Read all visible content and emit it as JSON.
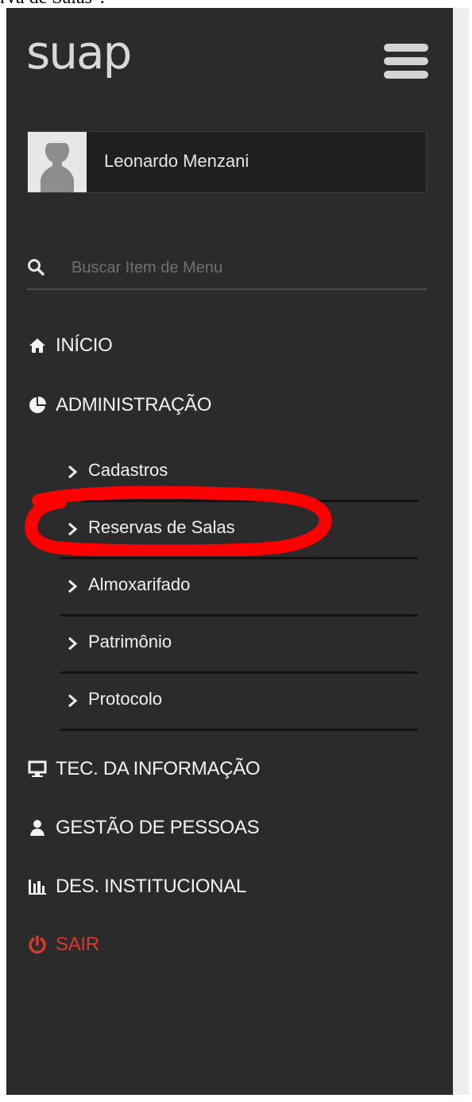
{
  "top_text": "rva de Salas\".",
  "brand": {
    "logo_text": "suap"
  },
  "user": {
    "name": "Leonardo Menzani"
  },
  "search": {
    "placeholder": "Buscar Item de Menu",
    "value": ""
  },
  "nav": {
    "items": [
      {
        "label": "INÍCIO",
        "icon": "home-icon"
      },
      {
        "label": "ADMINISTRAÇÃO",
        "icon": "pie-chart-icon"
      },
      {
        "label": "TEC. DA INFORMAÇÃO",
        "icon": "monitor-icon"
      },
      {
        "label": "GESTÃO DE PESSOAS",
        "icon": "person-icon"
      },
      {
        "label": "DES. INSTITUCIONAL",
        "icon": "bar-chart-icon"
      },
      {
        "label": "SAIR",
        "icon": "power-icon"
      }
    ],
    "administration_submenu": [
      {
        "label": "Cadastros"
      },
      {
        "label": "Reservas de Salas"
      },
      {
        "label": "Almoxarifado"
      },
      {
        "label": "Patrimônio"
      },
      {
        "label": "Protocolo"
      }
    ]
  },
  "colors": {
    "sidebar_bg": "#2b2b2b",
    "text_primary": "#f2f2f2",
    "accent_logout": "#d9392d",
    "highlight_annotation": "#ff0000",
    "content_bg": "#eeeeee"
  }
}
